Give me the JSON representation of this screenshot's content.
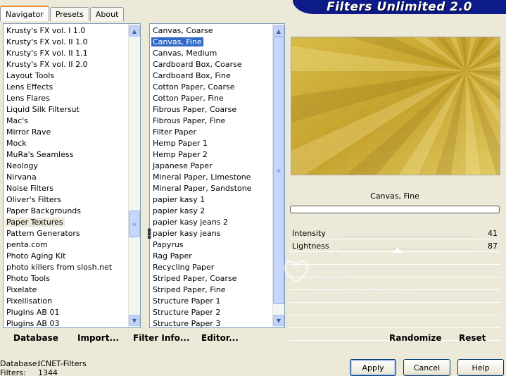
{
  "tabs": [
    {
      "label": "Navigator"
    },
    {
      "label": "Presets"
    },
    {
      "label": "About"
    }
  ],
  "banner_title": "Filters Unlimited 2.0",
  "categories": [
    "Krusty's FX vol. I 1.0",
    "Krusty's FX vol. II 1.0",
    "Krusty's FX vol. II 1.1",
    "Krusty's FX vol. II 2.0",
    "Layout Tools",
    "Lens Effects",
    "Lens Flares",
    "Liquid Silk Filtersut",
    "Mac's",
    "Mirror Rave",
    "Mock",
    "MuRa's Seamless",
    "Neology",
    "Nirvana",
    "Noise Filters",
    "Oliver's Filters",
    "Paper Backgrounds",
    "Paper Textures",
    "Pattern Generators",
    "penta.com",
    "Photo Aging Kit",
    "photo killers from slosh.net",
    "Photo Tools",
    "Pixelate",
    "Pixellisation",
    "Plugins AB 01",
    "Plugins AB 03"
  ],
  "selected_category": "Paper Textures",
  "filters": [
    "Canvas, Coarse",
    "Canvas, Fine",
    "Canvas, Medium",
    "Cardboard Box, Coarse",
    "Cardboard Box, Fine",
    "Cotton Paper, Coarse",
    "Cotton Paper, Fine",
    "Fibrous Paper, Coarse",
    "Fibrous Paper, Fine",
    "Filter Paper",
    "Hemp Paper 1",
    "Hemp Paper 2",
    "Japanese Paper",
    "Mineral Paper, Limestone",
    "Mineral Paper, Sandstone",
    "papier kasy 1",
    "papier kasy 2",
    "papier kasy jeans 2",
    "papier kasy jeans",
    "Papyrus",
    "Rag Paper",
    "Recycling Paper",
    "Striped Paper, Coarse",
    "Striped Paper, Fine",
    "Structure Paper 1",
    "Structure Paper 2",
    "Structure Paper 3"
  ],
  "selected_filter": "Canvas, Fine",
  "left_buttons": {
    "database": "Database",
    "import": "Import...",
    "filter_info": "Filter Info...",
    "editor": "Editor..."
  },
  "preview": {
    "filter_name": "Canvas, Fine"
  },
  "params": [
    {
      "label": "Intensity",
      "value": "41",
      "fraction": 0.41
    },
    {
      "label": "Lightness",
      "value": "87",
      "fraction": 0.87
    }
  ],
  "right_buttons": {
    "randomize": "Randomize",
    "reset": "Reset"
  },
  "watermark": {
    "line1": "Pinuccia",
    "line2": "www.maidiregrafica.eu"
  },
  "status": {
    "database_label": "Database:",
    "database_value": "ICNET-Filters",
    "filters_label": "Filters:",
    "filters_value": "1344"
  },
  "dialog_buttons": {
    "apply": "Apply",
    "cancel": "Cancel",
    "help": "Help"
  },
  "colors": {
    "banner": "#0c1a8a",
    "selection": "#316ac5",
    "preview_gold": "#c9a72c"
  }
}
